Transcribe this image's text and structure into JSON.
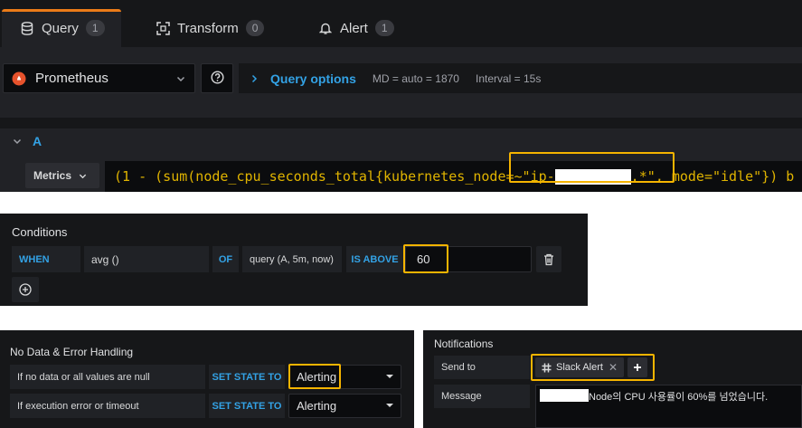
{
  "tabs": [
    {
      "label": "Query",
      "count": "1",
      "icon": "database-icon"
    },
    {
      "label": "Transform",
      "count": "0",
      "icon": "transform-icon"
    },
    {
      "label": "Alert",
      "count": "1",
      "icon": "bell-icon"
    }
  ],
  "datasource": {
    "name": "Prometheus"
  },
  "query_options": {
    "label": "Query options",
    "md": "MD = auto = 1870",
    "interval": "Interval = 15s"
  },
  "query": {
    "ref": "A",
    "metrics_label": "Metrics",
    "expr_part1": "(1 - (sum(node_cpu_seconds_total{kubernetes_node=~\"ip-",
    "expr_part2": ".*\", mode=\"idle\"}) b"
  },
  "conditions": {
    "title": "Conditions",
    "when": "WHEN",
    "reducer": "avg ()",
    "of": "OF",
    "query": "query (A, 5m, now)",
    "evaluator": "IS ABOVE",
    "threshold": "60"
  },
  "nodata": {
    "title": "No Data & Error Handling",
    "rows": [
      {
        "label": "If no data or all values are null",
        "set_state": "SET STATE TO",
        "value": "Alerting"
      },
      {
        "label": "If execution error or timeout",
        "set_state": "SET STATE TO",
        "value": "Alerting"
      }
    ]
  },
  "notifications": {
    "title": "Notifications",
    "send_to_label": "Send to",
    "channel": "Slack Alert",
    "message_label": "Message",
    "message": "Node의 CPU 사용률이 60%를 넘었습니다."
  },
  "colors": {
    "accent": "#33a2e5",
    "highlight": "#f5b400",
    "brand_orange": "#e6522c",
    "tab_active": "#eb7b18"
  }
}
